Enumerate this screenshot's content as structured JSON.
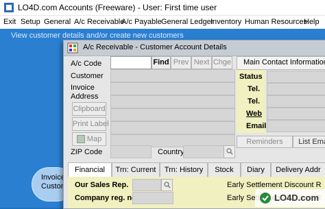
{
  "window": {
    "title": "LO4D.com Accounts (Freeware) - User: First time user"
  },
  "menubar": {
    "items": [
      "Exit",
      "Setup",
      "General",
      "A/c Receivable",
      "A/c Payable",
      "General Ledger",
      "Inventory",
      "Human Resources",
      "Help"
    ]
  },
  "workspace": {
    "tip": "View customer details and/or create new customers",
    "bubble_line1": "Invoice",
    "bubble_line2": "Custom"
  },
  "dialog": {
    "title": "A/c Receivable  -  Customer Account Details",
    "labels": {
      "ac_code": "A/c Code",
      "customer": "Customer",
      "invoice_address": "Invoice\nAddress",
      "zip_code": "ZIP Code",
      "country": "Country"
    },
    "buttons": {
      "find": "Find",
      "prev": "Prev",
      "next": "Next",
      "chge": "Chge",
      "clipboard": "Clipboard",
      "print_label": "Print Label",
      "map": "Map",
      "reminders": "Reminders",
      "list_emails": "List Ema"
    },
    "contact": {
      "header": "Main Contact Information",
      "status": "Status",
      "tel1": "Tel.",
      "tel2": "Tel.",
      "web": "Web",
      "email": "Email"
    },
    "tabs": [
      "Financial",
      "Trn: Current",
      "Trn: History",
      "Stock",
      "Diary",
      "Delivery Addr"
    ],
    "active_tab": "Financial",
    "financial": {
      "sales_rep": "Our Sales Rep.",
      "company_reg": "Company reg. no.",
      "early_discount_1": "Early Settlement Discount R",
      "early_discount_2": "Early Settlement Discount R"
    }
  },
  "watermark": {
    "text": "LO4D.com"
  }
}
